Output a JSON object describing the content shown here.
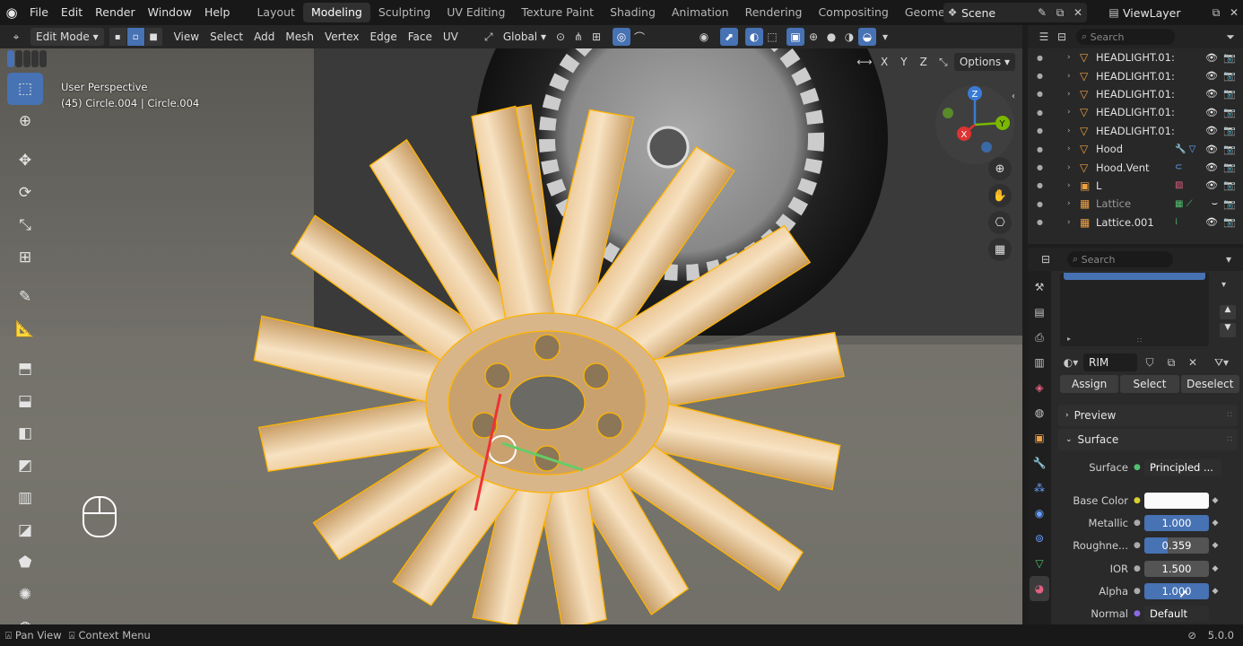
{
  "menubar": {
    "items": [
      "File",
      "Edit",
      "Render",
      "Window",
      "Help"
    ],
    "workspaces": [
      "Layout",
      "Modeling",
      "Sculpting",
      "UV Editing",
      "Texture Paint",
      "Shading",
      "Animation",
      "Rendering",
      "Compositing",
      "Geometry Nodes"
    ],
    "active_workspace": "Modeling",
    "scene": "Scene",
    "view_layer": "ViewLayer"
  },
  "header": {
    "mode": "Edit Mode",
    "menus": [
      "View",
      "Select",
      "Add",
      "Mesh",
      "Vertex",
      "Edge",
      "Face",
      "UV"
    ],
    "transform": "Global",
    "axes": [
      "X",
      "Y",
      "Z"
    ],
    "options": "Options"
  },
  "viewport": {
    "perspective": "User Perspective",
    "object_info": "(45) Circle.004 | Circle.004"
  },
  "outliner": {
    "search_placeholder": "Search",
    "rows": [
      {
        "label": "HEADLIGHT.01:",
        "extra": ""
      },
      {
        "label": "HEADLIGHT.01:",
        "extra": ""
      },
      {
        "label": "HEADLIGHT.01:",
        "extra": ""
      },
      {
        "label": "HEADLIGHT.01:",
        "extra": ""
      },
      {
        "label": "HEADLIGHT.01:",
        "extra": ""
      },
      {
        "label": "Hood",
        "extra": ""
      },
      {
        "label": "Hood.Vent",
        "extra": ""
      },
      {
        "label": "L",
        "extra": ""
      },
      {
        "label": "Lattice",
        "extra": ""
      },
      {
        "label": "Lattice.001",
        "extra": ""
      }
    ]
  },
  "properties": {
    "search_placeholder": "Search",
    "material_name": "RIM",
    "buttons": {
      "assign": "Assign",
      "select": "Select",
      "deselect": "Deselect"
    },
    "panels": {
      "preview": "Preview",
      "surface": "Surface"
    },
    "fields": {
      "surface_label": "Surface",
      "surface_value": "Principled ...",
      "base_color_label": "Base Color",
      "metallic_label": "Metallic",
      "metallic_value": "1.000",
      "roughness_label": "Roughne...",
      "roughness_value": "0.359",
      "ior_label": "IOR",
      "ior_value": "1.500",
      "alpha_label": "Alpha",
      "alpha_value": "1.000",
      "normal_label": "Normal",
      "normal_value": "Default"
    },
    "colors": {
      "base_color": "#fafafa",
      "accent": "#4772b3"
    }
  },
  "statusbar": {
    "pan_view": "Pan View",
    "context_menu": "Context Menu",
    "version": "5.0.0"
  }
}
